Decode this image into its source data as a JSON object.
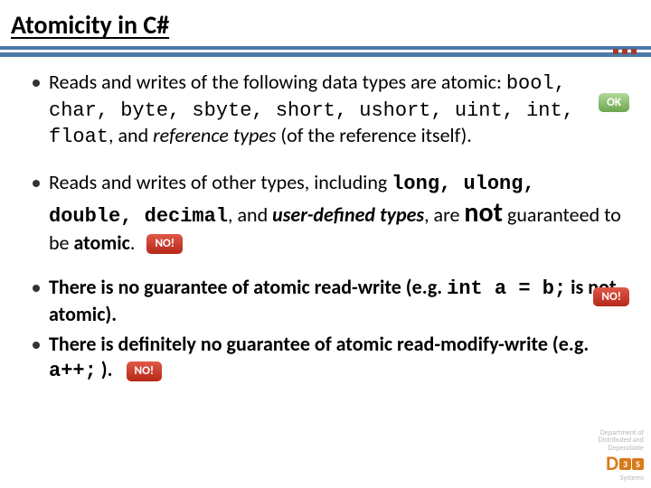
{
  "title": "Atomicity in C#",
  "badges": {
    "ok": "OK",
    "no": "NO!"
  },
  "bullets": {
    "b1": {
      "t1": "Reads and writes of the following data types are atomic: ",
      "types": "bool, char, byte, sbyte, short, ushort, uint, int, float",
      "t2": ", and ",
      "ref": "reference types",
      "t3": " (of the reference itself)."
    },
    "b2": {
      "t1": "Reads and writes of other types, including ",
      "types": "long, ulong, double, decimal",
      "t2": ", and ",
      "ud": "user-defined types",
      "t3": ", are ",
      "not": "not",
      "t4": " guaranteed to be ",
      "atomic": "atomic",
      "t5": "."
    },
    "b3": {
      "t1": "There is ",
      "ng": "no guarantee of atomic read-write",
      "t2": " (e.g. ",
      "code": "int a = b;",
      "t3": " is not atomic)."
    },
    "b4": {
      "t1": "There is definitely ",
      "ng": "no guarantee of atomic read-modify-write",
      "t2": " (e.g. ",
      "code": "a++;",
      "t3": " )."
    }
  },
  "footer": {
    "l1": "Department of",
    "l2": "Distributed and",
    "l3": "Dependable",
    "l4": "Systems",
    "logo_d": "D",
    "logo_3": "3",
    "logo_s": "S"
  }
}
